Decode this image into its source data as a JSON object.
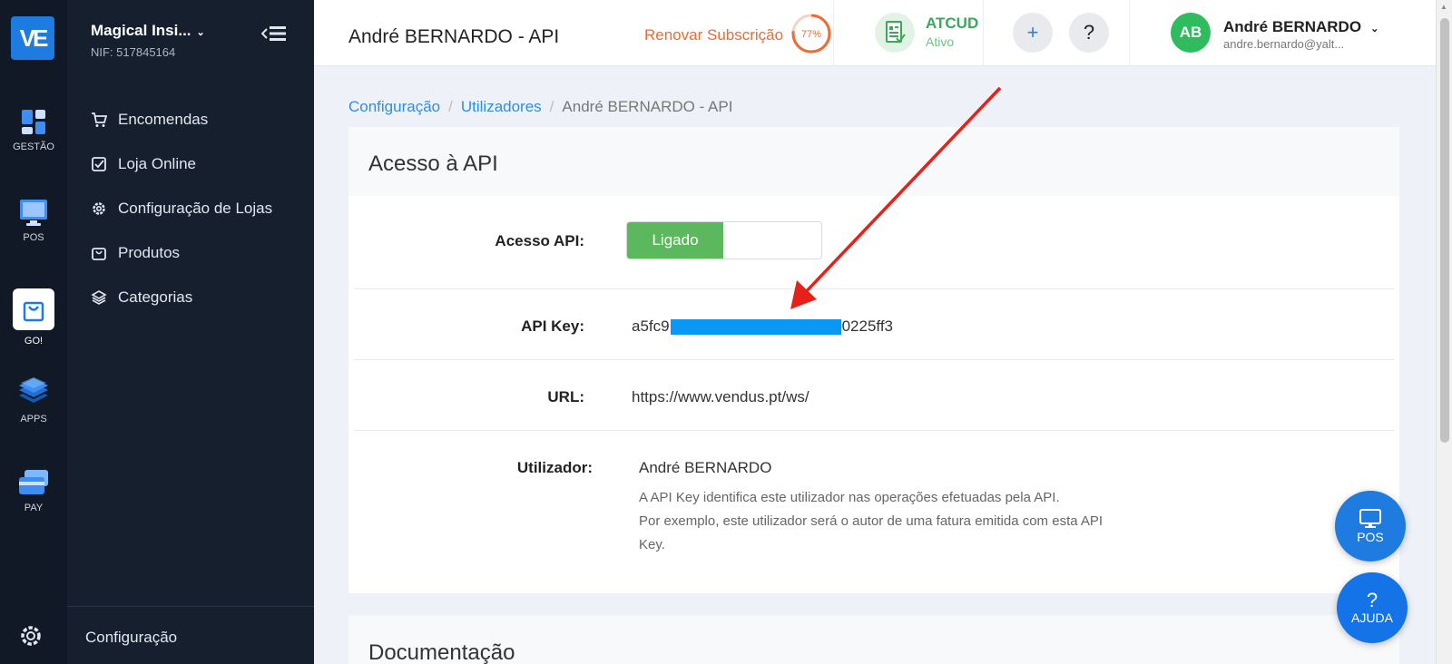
{
  "app": {
    "logo_text": "VE",
    "brand_color": "#1e7be0"
  },
  "rail": [
    {
      "id": "gestao",
      "label": "GESTÃO",
      "icon": "dashboard-icon"
    },
    {
      "id": "pos",
      "label": "POS",
      "icon": "monitor-icon"
    },
    {
      "id": "go",
      "label": "GO!",
      "icon": "shopping-bag-icon"
    },
    {
      "id": "apps",
      "label": "APPS",
      "icon": "layers-icon"
    },
    {
      "id": "pay",
      "label": "PAY",
      "icon": "credit-card-icon"
    }
  ],
  "company": {
    "name": "Magical Insi...",
    "nif": "NIF: 517845164"
  },
  "menu": {
    "items": [
      {
        "label": "Encomendas",
        "icon": "cart-icon"
      },
      {
        "label": "Loja Online",
        "icon": "checkbox-icon"
      },
      {
        "label": "Configuração de Lojas",
        "icon": "gear-icon"
      },
      {
        "label": "Produtos",
        "icon": "bag-icon"
      },
      {
        "label": "Categorias",
        "icon": "stack-icon"
      }
    ],
    "footer_label": "Configuração"
  },
  "header": {
    "title": "André BERNARDO - API",
    "renew_label": "Renovar Subscrição",
    "renew_progress": 77,
    "renew_progress_label": "77%",
    "atcud_title": "ATCUD",
    "atcud_status": "Ativo",
    "add_label": "+",
    "help_label": "?",
    "user_initials": "AB",
    "user_name": "André BERNARDO",
    "user_email": "andre.bernardo@yalt..."
  },
  "breadcrumb": {
    "items": [
      "Configuração",
      "Utilizadores",
      "André BERNARDO - API"
    ]
  },
  "api_card": {
    "title": "Acesso à API",
    "access_label": "Acesso API:",
    "toggle_on_label": "Ligado",
    "key_label": "API Key:",
    "key_prefix": "a5fc9",
    "key_suffix": "0225ff3",
    "url_label": "URL:",
    "url_value": "https://www.vendus.pt/ws/",
    "user_label": "Utilizador:",
    "user_value": "André BERNARDO",
    "help_line1": "A API Key identifica este utilizador nas operações efetuadas pela API.",
    "help_line2": "Por exemplo, este utilizador será o autor de uma fatura emitida com esta API Key."
  },
  "docs_card": {
    "title": "Documentação"
  },
  "fabs": {
    "pos_label": "POS",
    "help_symbol": "?",
    "help_label": "AJUDA"
  },
  "colors": {
    "renew": "#f06a32",
    "atcud": "#3aa75a",
    "toggle_on": "#5cb85c",
    "link": "#2f8ee0",
    "annotation_arrow": "#e8201a"
  }
}
